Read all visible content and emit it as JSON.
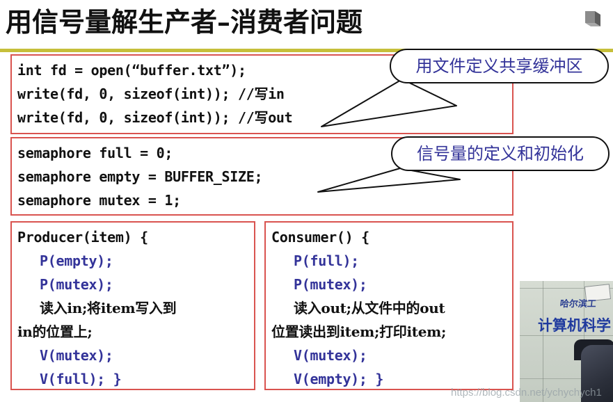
{
  "slide": {
    "title": "用信号量解生产者–消费者问题",
    "accent_divider_color": "#c6bf3a",
    "code_border_color": "#d9534f",
    "code_text_color": "#111111",
    "highlight_text_color": "#333399"
  },
  "code_blocks": {
    "file_setup": {
      "lines": [
        "int fd = open(“buffer.txt”);",
        "write(fd, 0, sizeof(int)); //写in",
        "write(fd, 0, sizeof(int)); //写out"
      ]
    },
    "semaphores": {
      "lines": [
        "semaphore full = 0;",
        "semaphore empty = BUFFER_SIZE;",
        "semaphore mutex = 1;"
      ]
    },
    "producer": {
      "header": "Producer(item) {",
      "l1": "P(empty);",
      "l2": "P(mutex);",
      "l3": "读入in;将item写入到",
      "l4": "in的位置上;",
      "l5": "V(mutex);",
      "l6": "V(full);  }"
    },
    "consumer": {
      "header": "Consumer() {",
      "l1": "P(full);",
      "l2": "P(mutex);",
      "l3": "读入out;从文件中的out",
      "l4": "位置读出到item;打印item;",
      "l5": "V(mutex);",
      "l6": "V(empty);  }"
    }
  },
  "callouts": [
    {
      "text": "用文件定义共享缓冲区"
    },
    {
      "text": "信号量的定义和初始化"
    }
  ],
  "video_overlay": {
    "banner_small": "哈尔滨工",
    "banner_big": "计算机科学"
  },
  "watermark": {
    "text": "https://blog.csdn.net/ychychych1"
  }
}
